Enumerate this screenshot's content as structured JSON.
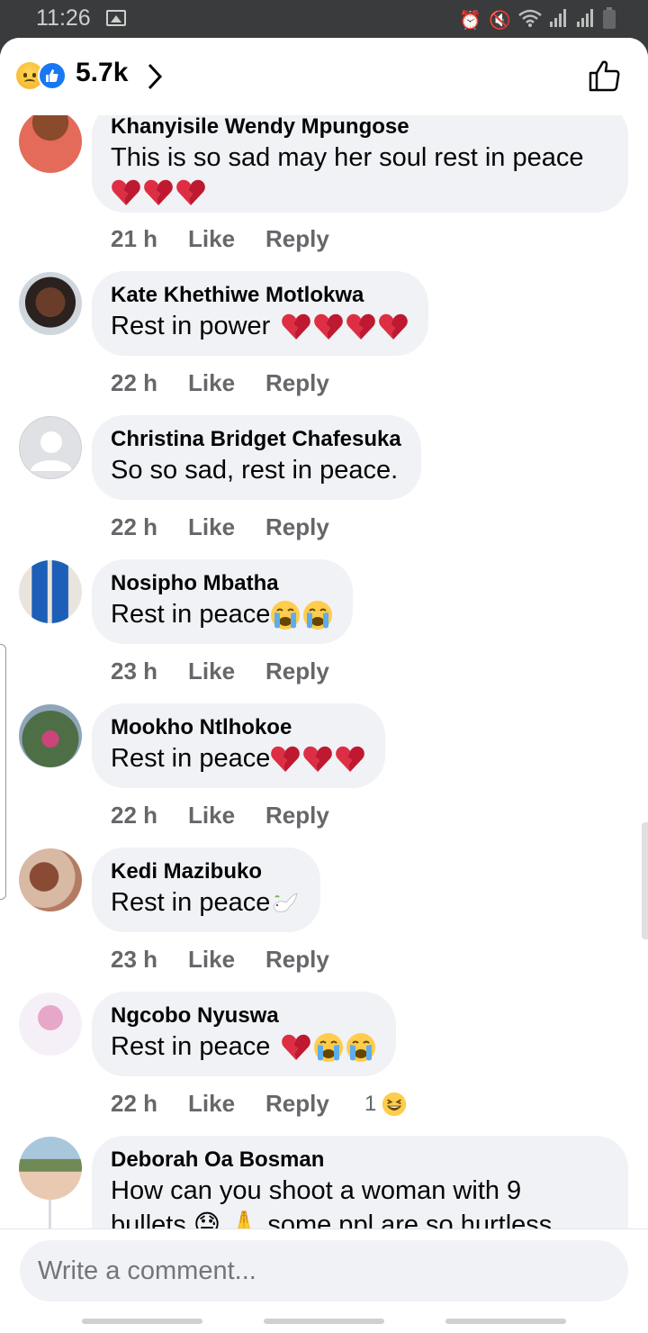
{
  "status_bar": {
    "time": "11:26"
  },
  "header": {
    "reaction_count": "5.7k"
  },
  "comments": [
    {
      "author": "Khanyisile Wendy Mpungose",
      "text": "This is so sad may her soul rest in peace",
      "emoji": [
        "broken-heart",
        "broken-heart",
        "broken-heart"
      ],
      "time": "21 h",
      "like": "Like",
      "reply": "Reply"
    },
    {
      "author": "Kate Khethiwe Motlokwa",
      "text": "Rest in power",
      "emoji": [
        "broken-heart",
        "broken-heart",
        "broken-heart",
        "broken-heart"
      ],
      "time": "22 h",
      "like": "Like",
      "reply": "Reply"
    },
    {
      "author": "Christina Bridget Chafesuka",
      "text": "So so sad, rest in peace.",
      "emoji": [],
      "time": "22 h",
      "like": "Like",
      "reply": "Reply"
    },
    {
      "author": "Nosipho Mbatha",
      "text": "Rest in peace",
      "emoji": [
        "crying-face",
        "crying-face"
      ],
      "time": "23 h",
      "like": "Like",
      "reply": "Reply"
    },
    {
      "author": "Mookho Ntlhokoe",
      "text": "Rest in peace",
      "emoji": [
        "broken-heart",
        "broken-heart",
        "broken-heart"
      ],
      "time": "22 h",
      "like": "Like",
      "reply": "Reply"
    },
    {
      "author": "Kedi Mazibuko",
      "text": "Rest in peace",
      "emoji": [
        "dove"
      ],
      "time": "23 h",
      "like": "Like",
      "reply": "Reply"
    },
    {
      "author": "Ngcobo Nyuswa",
      "text": "Rest in peace",
      "emoji": [
        "broken-heart",
        "crying-face",
        "crying-face"
      ],
      "time": "22 h",
      "like": "Like",
      "reply": "Reply",
      "reaction_count": "1",
      "reaction": "laughing-face"
    },
    {
      "author": "Deborah Oa Bosman",
      "text": "How can you shoot a woman with 9",
      "text2": "bullets 😓 🙏 some ppl are so hurtless",
      "time": "",
      "like": "",
      "reply": ""
    }
  ],
  "composer": {
    "placeholder": "Write a comment..."
  }
}
